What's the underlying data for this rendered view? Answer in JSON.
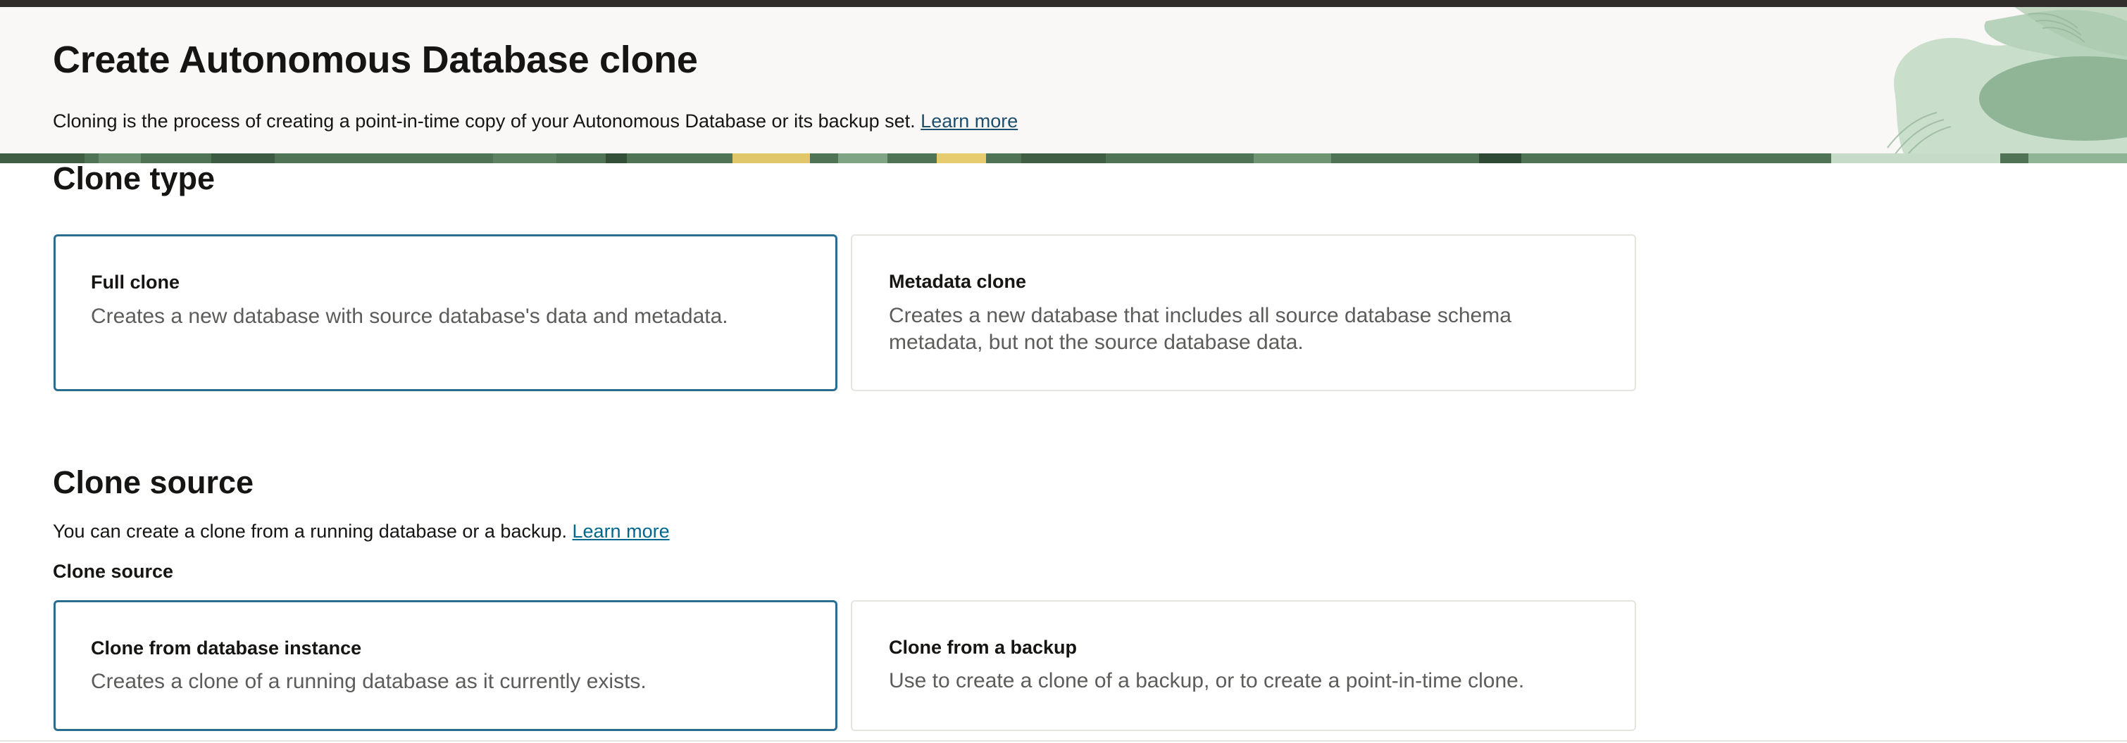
{
  "header": {
    "title": "Create Autonomous Database clone",
    "description": "Cloning is the process of creating a point-in-time copy of your Autonomous Database or its backup set.",
    "learn_more": "Learn more"
  },
  "clone_type": {
    "heading": "Clone type",
    "options": [
      {
        "title": "Full clone",
        "description": "Creates a new database with source database's data and metadata.",
        "selected": true
      },
      {
        "title": "Metadata clone",
        "description": "Creates a new database that includes all source database schema metadata, but not the source database data.",
        "selected": false
      }
    ]
  },
  "clone_source": {
    "heading": "Clone source",
    "description": "You can create a clone from a running database or a backup.",
    "learn_more": "Learn more",
    "label": "Clone source",
    "options": [
      {
        "title": "Clone from database instance",
        "description": "Creates a clone of a running database as it currently exists.",
        "selected": true
      },
      {
        "title": "Clone from a backup",
        "description": "Use to create a clone of a backup, or to create a point-in-time clone.",
        "selected": false
      }
    ]
  },
  "colors": {
    "header_bg": "#f9f8f6",
    "selected_border": "#2b6d8f",
    "link": "#00688c",
    "banner_green": "#4f7354"
  }
}
